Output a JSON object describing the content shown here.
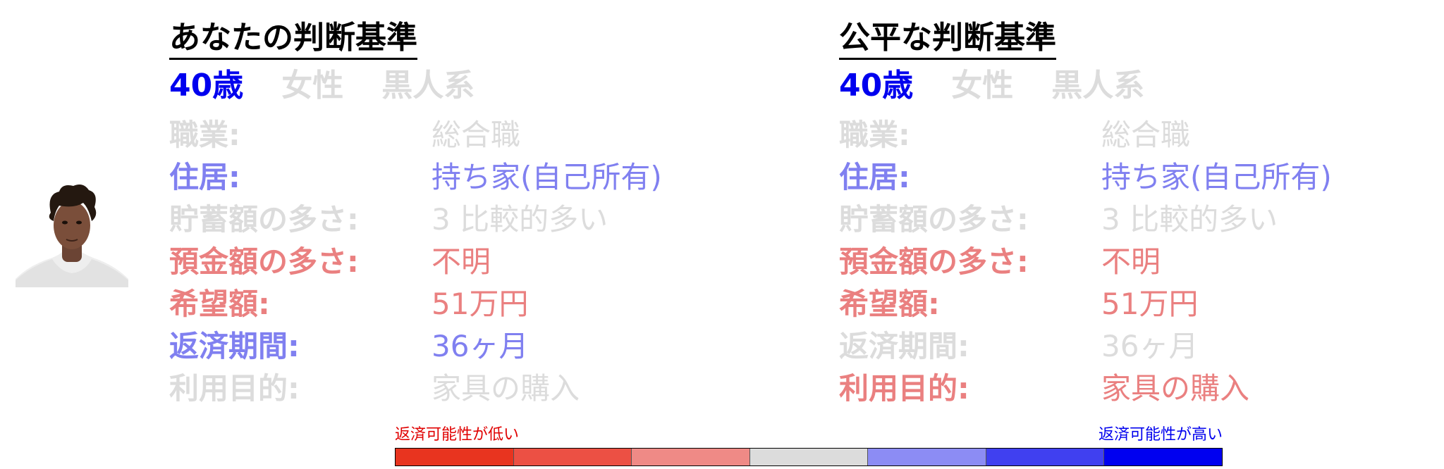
{
  "colors": {
    "blue": "#0000ee",
    "light_blue": "#8080f0",
    "light_red": "#ea8080",
    "faded": "#dcdcdc"
  },
  "avatar": {
    "icon": "person-photo"
  },
  "panels": [
    {
      "title": "あなたの判断基準",
      "tags": [
        {
          "text": "40歳",
          "color": "#0000ee"
        },
        {
          "text": "女性",
          "color": "#dcdcdc"
        },
        {
          "text": "黒人系",
          "color": "#dcdcdc"
        }
      ],
      "rows": [
        {
          "label": "職業:",
          "value": "総合職",
          "color": "#dcdcdc"
        },
        {
          "label": "住居:",
          "value": "持ち家(自己所有)",
          "color": "#8080f0"
        },
        {
          "label": "貯蓄額の多さ:",
          "value": "3 比較的多い",
          "color": "#dcdcdc"
        },
        {
          "label": "預金額の多さ:",
          "value": "不明",
          "color": "#ea8080"
        },
        {
          "label": "希望額:",
          "value": "51万円",
          "color": "#ea8080"
        },
        {
          "label": "返済期間:",
          "value": "36ヶ月",
          "color": "#8080f0"
        },
        {
          "label": "利用目的:",
          "value": "家具の購入",
          "color": "#dcdcdc"
        }
      ]
    },
    {
      "title": "公平な判断基準",
      "tags": [
        {
          "text": "40歳",
          "color": "#0000ee"
        },
        {
          "text": "女性",
          "color": "#dcdcdc"
        },
        {
          "text": "黒人系",
          "color": "#dcdcdc"
        }
      ],
      "rows": [
        {
          "label": "職業:",
          "value": "総合職",
          "color": "#dcdcdc"
        },
        {
          "label": "住居:",
          "value": "持ち家(自己所有)",
          "color": "#8080f0"
        },
        {
          "label": "貯蓄額の多さ:",
          "value": "3 比較的多い",
          "color": "#dcdcdc"
        },
        {
          "label": "預金額の多さ:",
          "value": "不明",
          "color": "#ea8080"
        },
        {
          "label": "希望額:",
          "value": "51万円",
          "color": "#ea8080"
        },
        {
          "label": "返済期間:",
          "value": "36ヶ月",
          "color": "#dcdcdc"
        },
        {
          "label": "利用目的:",
          "value": "家具の購入",
          "color": "#ea8080"
        }
      ]
    }
  ],
  "legend": {
    "low_label": "返済可能性が低い",
    "high_label": "返済可能性が高い",
    "low_color": "#e00000",
    "high_color": "#0000ee",
    "swatches": [
      "#e8341f",
      "#ec5044",
      "#ef8a86",
      "#dcdcdc",
      "#8c8cf4",
      "#4040f0",
      "#0000f0"
    ]
  }
}
